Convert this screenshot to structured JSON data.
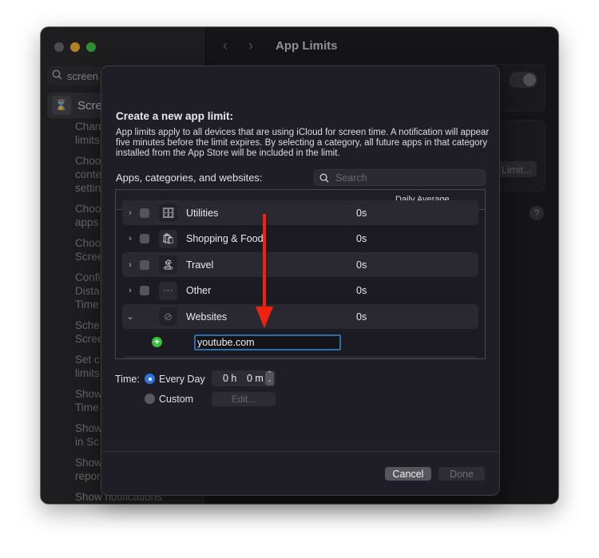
{
  "window": {
    "title": "App Limits",
    "sidebar": {
      "search_value": "screen t",
      "selected_item": "Screen Time",
      "items": [
        "Chan\nlimits",
        "Choo\nconte\nsettin",
        "Choo\napps",
        "Choo\nScree",
        "Confi\nDista\nTime",
        "Sche\nScree",
        "Set c\nlimits",
        "Show\nTime",
        "Show\nin Sc",
        "Show\nrepor",
        "Show notifications"
      ]
    },
    "background": {
      "limit_button": "Limit...",
      "help": "?"
    }
  },
  "sheet": {
    "title": "Create a new app limit:",
    "description": "App limits apply to all devices that are using iCloud for screen time. A notification will appear five minutes before the limit expires. By selecting a category, all future apps in that category installed from the App Store will be included in the limit.",
    "list_label": "Apps, categories, and websites:",
    "search_placeholder": "Search",
    "table": {
      "column_header": "Daily Average",
      "rows": [
        {
          "name": "Utilities",
          "avg": "0s",
          "icon": "🗄",
          "expanded": false,
          "checkbox": true
        },
        {
          "name": "Shopping & Food",
          "avg": "0s",
          "icon": "🛍",
          "expanded": false,
          "checkbox": true
        },
        {
          "name": "Travel",
          "avg": "0s",
          "icon": "🏝",
          "expanded": false,
          "checkbox": true
        },
        {
          "name": "Other",
          "avg": "0s",
          "icon": "⋯",
          "expanded": false,
          "checkbox": true
        },
        {
          "name": "Websites",
          "avg": "0s",
          "icon": "⊘",
          "expanded": true,
          "checkbox": false
        }
      ],
      "website_input_value": "youtube.com"
    },
    "time": {
      "label": "Time:",
      "options": [
        {
          "label": "Every Day",
          "selected": true
        },
        {
          "label": "Custom",
          "selected": false
        }
      ],
      "hours": "0 h",
      "minutes": "0 m",
      "edit_label": "Edit..."
    },
    "buttons": {
      "cancel": "Cancel",
      "done": "Done"
    }
  },
  "annotation": {
    "arrow_color": "#f0220f"
  }
}
